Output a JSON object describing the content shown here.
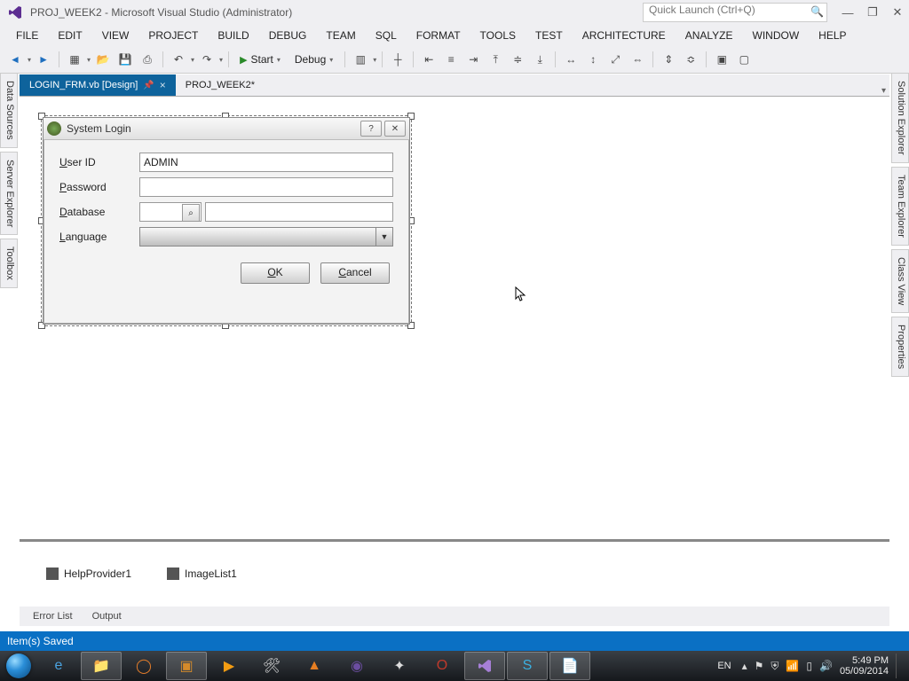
{
  "titlebar": {
    "title": "PROJ_WEEK2 - Microsoft Visual Studio (Administrator)",
    "quicklaunch_placeholder": "Quick Launch (Ctrl+Q)"
  },
  "menu": [
    "FILE",
    "EDIT",
    "VIEW",
    "PROJECT",
    "BUILD",
    "DEBUG",
    "TEAM",
    "SQL",
    "FORMAT",
    "TOOLS",
    "TEST",
    "ARCHITECTURE",
    "ANALYZE",
    "WINDOW",
    "HELP"
  ],
  "toolbar": {
    "start_label": "Start",
    "config_label": "Debug"
  },
  "left_panels": [
    "Data Sources",
    "Server Explorer",
    "Toolbox"
  ],
  "right_panels": [
    "Solution Explorer",
    "Team Explorer",
    "Class View",
    "Properties"
  ],
  "tabs": {
    "active": "LOGIN_FRM.vb [Design]",
    "inactive": "PROJ_WEEK2*"
  },
  "form": {
    "title": "System Login",
    "labels": {
      "user_id": "User ID",
      "password": "Password",
      "database": "Database",
      "language": "Language"
    },
    "values": {
      "user_id": "ADMIN",
      "password": "",
      "database_short": "",
      "database_name": "",
      "language": ""
    },
    "buttons": {
      "ok": "OK",
      "cancel": "Cancel"
    }
  },
  "component_tray": {
    "help_provider": "HelpProvider1",
    "image_list": "ImageList1"
  },
  "bottom_tabs": [
    "Error List",
    "Output"
  ],
  "statusbar": {
    "text": "Item(s) Saved"
  },
  "taskbar": {
    "lang": "EN",
    "time": "5:49 PM",
    "date": "05/09/2014"
  }
}
